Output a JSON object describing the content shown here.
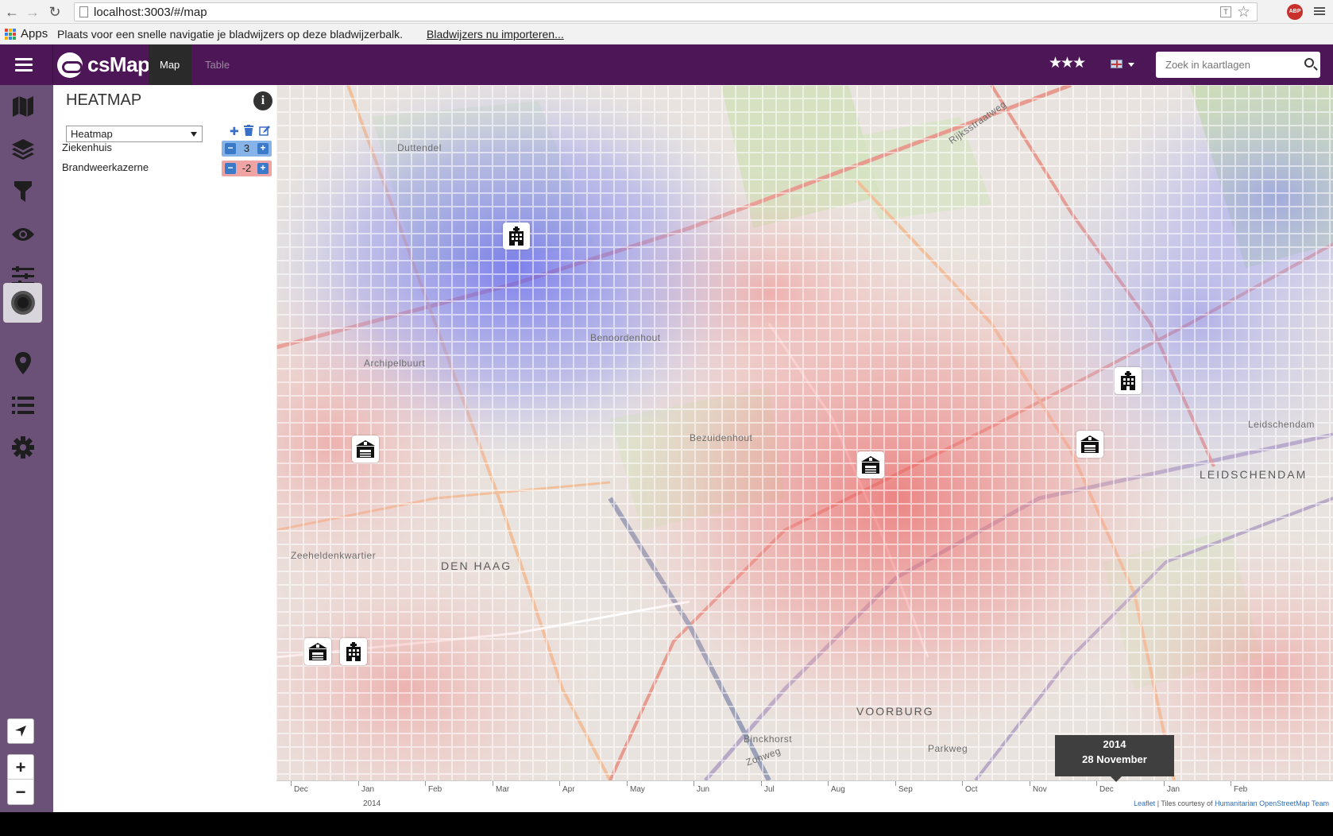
{
  "browser": {
    "url": "localhost:3003/#/map",
    "apps_label": "Apps",
    "bookmarks_text": "Plaats voor een snelle navigatie je bladwijzers op deze bladwijzerbalk.",
    "bookmarks_link": "Bladwijzers nu importeren...",
    "adblock_label": "ABP"
  },
  "topnav": {
    "brand": "csMap",
    "tabs": [
      {
        "label": "Map",
        "active": true
      },
      {
        "label": "Table",
        "active": false
      }
    ],
    "rating": "★★★",
    "search_placeholder": "Zoek in kaartlagen"
  },
  "sidebar": {
    "icons": [
      "map-icon",
      "layers-icon",
      "filter-icon",
      "eye-icon",
      "sliders-icon",
      "heatmap-icon",
      "marker-icon",
      "list-icon",
      "gear-icon"
    ],
    "active_icon": "heatmap-icon"
  },
  "panel": {
    "title": "HEATMAP",
    "selected_heatmap": "Heatmap",
    "items": [
      {
        "label": "Ziekenhuis",
        "weight": "3",
        "color": "#86b3e8"
      },
      {
        "label": "Brandweerkazerne",
        "weight": "-2",
        "color": "#f0a3a3"
      }
    ]
  },
  "map": {
    "labels": {
      "den_haag": "DEN HAAG",
      "leidschendam": "LEIDSCHENDAM",
      "voorburg": "VOORBURG",
      "bezuidenhout": "Bezuidenhout",
      "benoordenhout": "Benoordenhout",
      "archipelbuurt": "Archipelbuurt",
      "duttendel": "Duttendel",
      "binckhorst": "Binckhorst",
      "parkweg": "Parkweg",
      "zeeheldenkwartier": "Zeeheldenkwartier",
      "leidschendam_small": "Leidschendam",
      "zonweg": "Zonweg",
      "rijksstraatweg": "Rijksstraatweg"
    },
    "zoom_in": "+",
    "zoom_out": "−"
  },
  "timeline": {
    "months": [
      "Dec",
      "Jan",
      "Feb",
      "Mar",
      "Apr",
      "May",
      "Jun",
      "Jul",
      "Aug",
      "Sep",
      "Oct",
      "Nov",
      "Dec",
      "Jan",
      "Feb"
    ],
    "year": "2014",
    "tooltip_year": "2014",
    "tooltip_date": "28 November",
    "attribution_leaflet": "Leaflet",
    "attribution_mid": "| Tiles courtesy of",
    "attribution_hot": "Humanitarian OpenStreetMap Team"
  },
  "colors": {
    "navbar": "#4c1657",
    "iconbar": "#6b5177",
    "heat_positive": "#7b7ff0",
    "heat_negative": "#f07f7f"
  }
}
